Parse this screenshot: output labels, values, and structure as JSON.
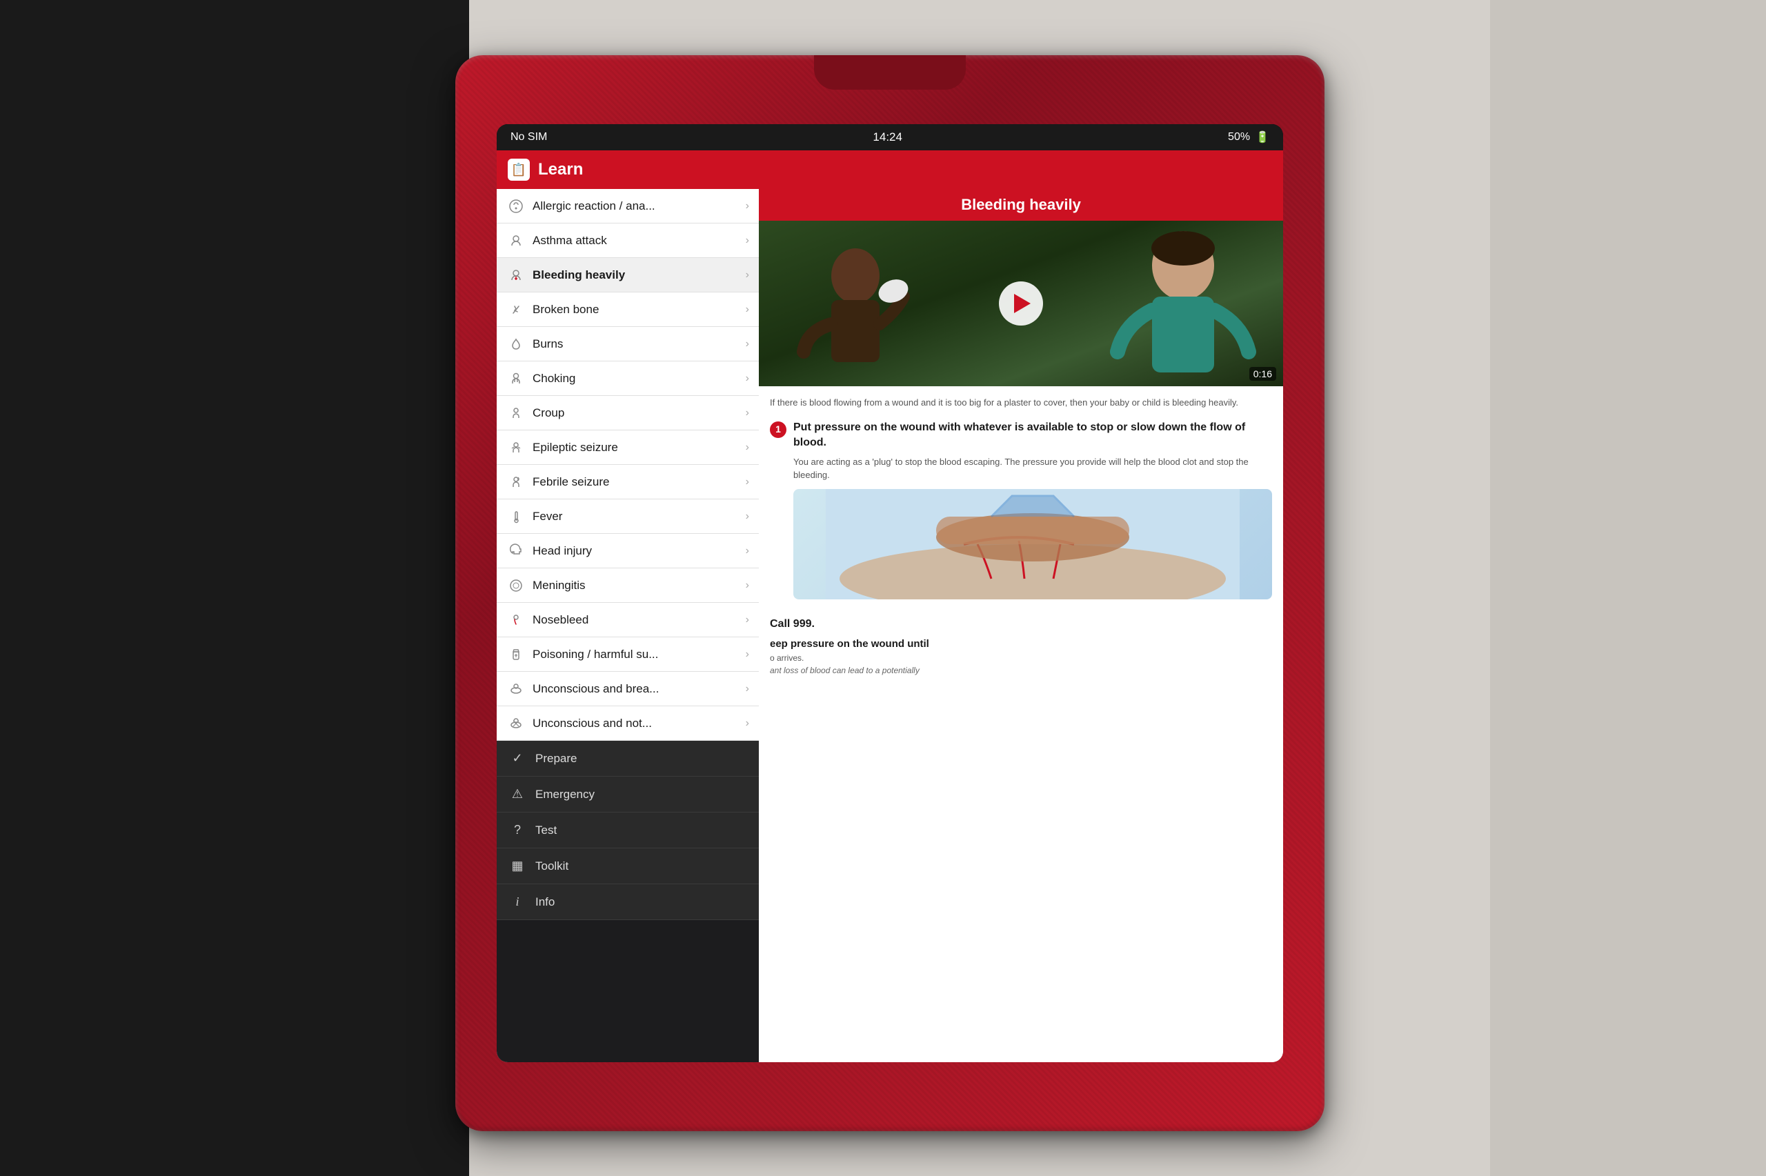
{
  "scene": {
    "bg_left_color": "#1a1a1a",
    "bg_main_color": "#d4d0cb"
  },
  "status_bar": {
    "carrier": "No SIM",
    "time": "14:24",
    "battery": "50%"
  },
  "app_header": {
    "title": "Learn",
    "icon": "📋"
  },
  "content_header": {
    "title": "Bleeding heavily"
  },
  "video": {
    "duration": "0:16"
  },
  "article": {
    "intro": "If there is blood flowing from a wound and it is too big for a plaster to cover, then your baby or child is bleeding heavily.",
    "step1_number": "1",
    "step1_title": "Put pressure on the wound with whatever is available to stop or slow down the flow of blood.",
    "step1_desc": "You are acting as a 'plug' to stop the blood escaping. The pressure you provide will help the blood clot and stop the bleeding.",
    "call_text": "Call 999.",
    "step2_title": "eep pressure on the wound until",
    "step2_sub": "o arrives.",
    "step2_note": "ant loss of blood can lead to a potentially"
  },
  "menu": {
    "items": [
      {
        "id": "allergic",
        "label": "Allergic reaction / ana...",
        "icon": "allergic"
      },
      {
        "id": "asthma",
        "label": "Asthma attack",
        "icon": "asthma"
      },
      {
        "id": "bleeding",
        "label": "Bleeding heavily",
        "icon": "bleeding",
        "active": true
      },
      {
        "id": "broken",
        "label": "Broken bone",
        "icon": "broken"
      },
      {
        "id": "burns",
        "label": "Burns",
        "icon": "burns"
      },
      {
        "id": "choking",
        "label": "Choking",
        "icon": "choking"
      },
      {
        "id": "croup",
        "label": "Croup",
        "icon": "croup"
      },
      {
        "id": "epileptic",
        "label": "Epileptic seizure",
        "icon": "epileptic"
      },
      {
        "id": "febrile",
        "label": "Febrile seizure",
        "icon": "febrile"
      },
      {
        "id": "fever",
        "label": "Fever",
        "icon": "fever"
      },
      {
        "id": "head",
        "label": "Head injury",
        "icon": "head"
      },
      {
        "id": "meningitis",
        "label": "Meningitis",
        "icon": "meningitis"
      },
      {
        "id": "nosebleed",
        "label": "Nosebleed",
        "icon": "nosebleed"
      },
      {
        "id": "poisoning",
        "label": "Poisoning / harmful su...",
        "icon": "poisoning"
      },
      {
        "id": "unconscious_b",
        "label": "Unconscious and brea...",
        "icon": "unconscious"
      },
      {
        "id": "unconscious_n",
        "label": "Unconscious and not...",
        "icon": "unconscious2"
      }
    ],
    "bottom_items": [
      {
        "id": "prepare",
        "label": "Prepare",
        "icon": "✓"
      },
      {
        "id": "emergency",
        "label": "Emergency",
        "icon": "⚠"
      },
      {
        "id": "test",
        "label": "Test",
        "icon": "?"
      },
      {
        "id": "toolkit",
        "label": "Toolkit",
        "icon": "▦"
      },
      {
        "id": "info",
        "label": "Info",
        "icon": "i"
      }
    ]
  }
}
